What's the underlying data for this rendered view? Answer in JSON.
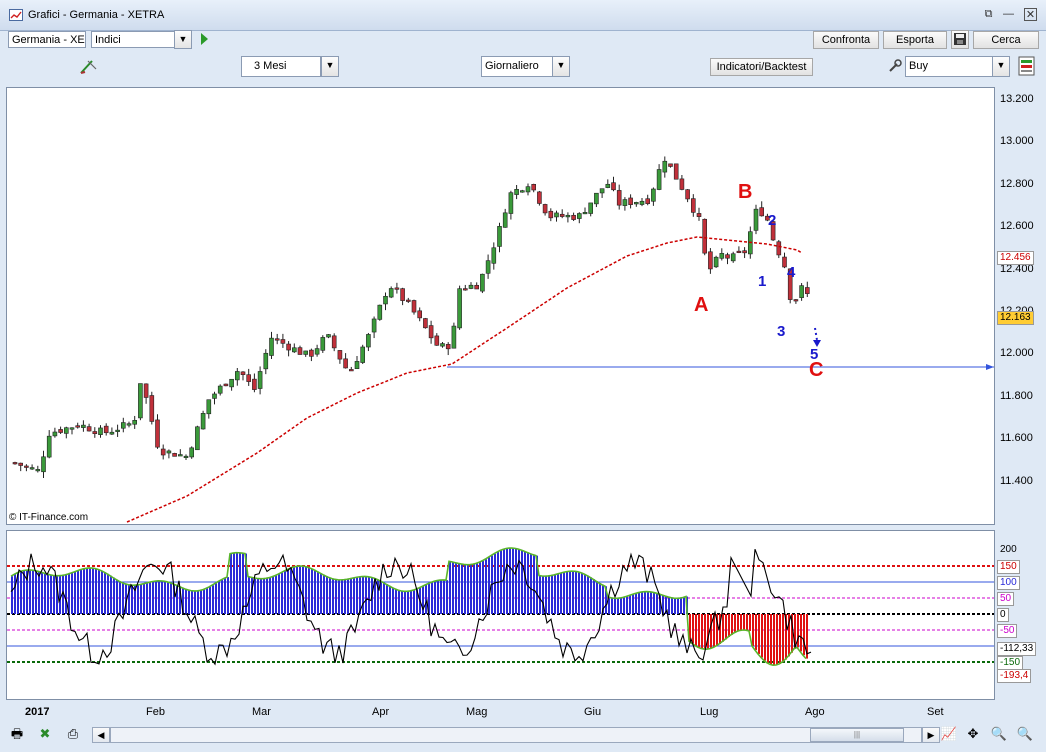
{
  "window": {
    "title": "Grafici  -  Germania - XETRA"
  },
  "toolbar1": {
    "market_value": "Germania - XE",
    "type_value": "Indici",
    "compare_label": "Confronta",
    "export_label": "Esporta",
    "search_label": "Cerca"
  },
  "toolbar2": {
    "period_value": "3 Mesi",
    "interval_value": "Giornaliero",
    "indicators_label": "Indicatori/Backtest",
    "order_value": "Buy"
  },
  "price_axis": {
    "ticks": [
      "13.200",
      "13.000",
      "12.800",
      "12.600",
      "12.400",
      "12.200",
      "12.000",
      "11.800",
      "11.600",
      "11.400"
    ]
  },
  "price_tags": {
    "ma_value": "12.456",
    "last_value": "12.163"
  },
  "osc_axis": {
    "ticks": [
      "200",
      "150",
      "100",
      "50",
      "0",
      "-50",
      "-112,33",
      "-150",
      "-193,4"
    ]
  },
  "copyright": "© IT-Finance.com",
  "months": {
    "year": "2017",
    "feb": "Feb",
    "mar": "Mar",
    "apr": "Apr",
    "mag": "Mag",
    "giu": "Giu",
    "lug": "Lug",
    "ago": "Ago",
    "set": "Set"
  },
  "annotations": {
    "a": "A",
    "b": "B",
    "c": "C",
    "w1": "1",
    "w2": "2",
    "w3": "3",
    "w4": "4",
    "w5": "5"
  },
  "colors": {
    "up": "#3a9a3a",
    "down": "#c0303a",
    "ma": "#cc0000",
    "support": "#3355dd",
    "osc_pos": "#2a2ad8",
    "osc_neg": "#e01010",
    "wave_blue": "#1a1acc",
    "wave_red": "#e01010"
  }
}
